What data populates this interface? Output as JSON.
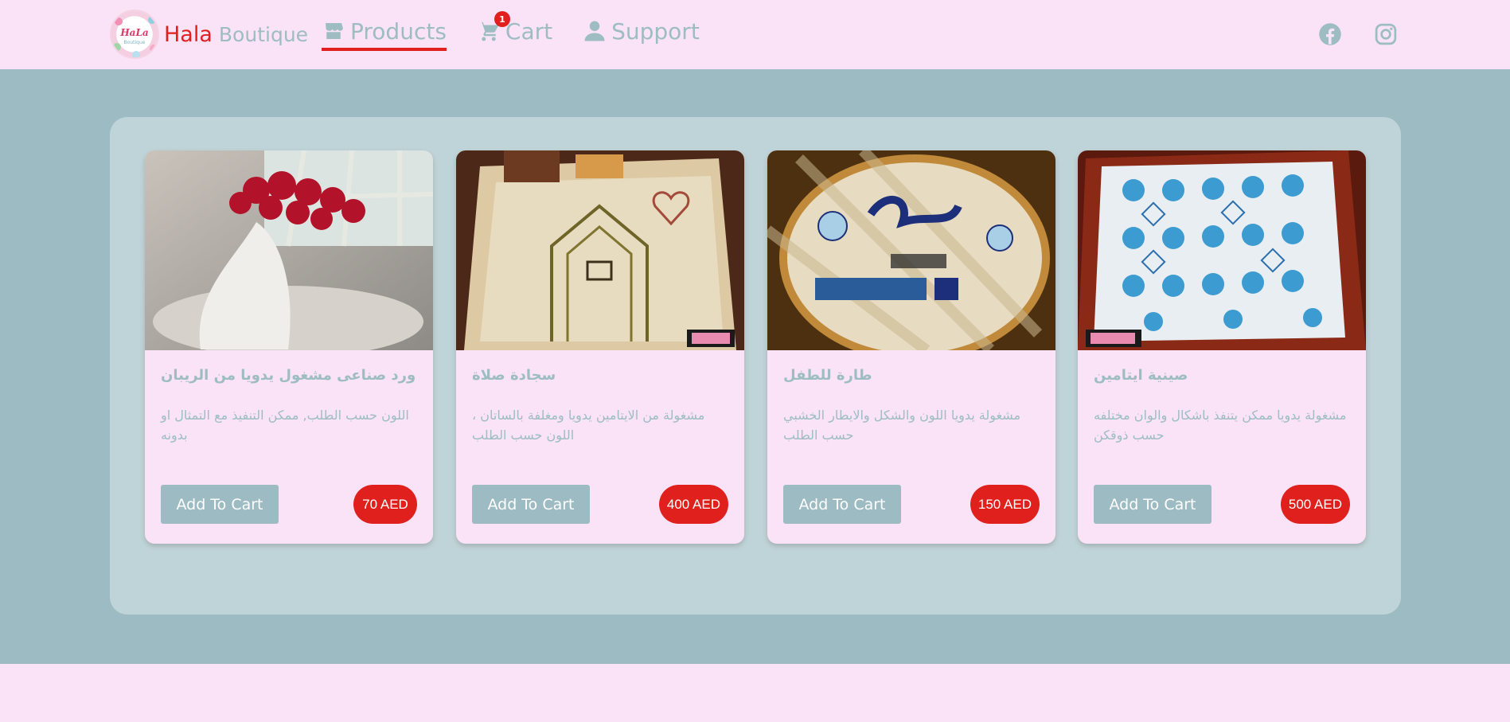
{
  "brand": {
    "logo_text": "HaLa",
    "logo_sub": "Boutique",
    "word1": "Hala",
    "word2": "Boutique"
  },
  "nav": {
    "items": [
      {
        "label": "Products",
        "icon": "store-icon",
        "active": true
      },
      {
        "label": "Cart",
        "icon": "cart-icon",
        "badge": "1"
      },
      {
        "label": "Support",
        "icon": "user-icon"
      }
    ]
  },
  "social": [
    "facebook-icon",
    "instagram-icon"
  ],
  "products": [
    {
      "title": "ورد صناعى مشغول يدويا من الريبان",
      "desc": "اللون حسب الطلب, ممكن التنفيذ مع التمثال او بدونه",
      "button": "Add To Cart",
      "price": "70 AED"
    },
    {
      "title": "سجادة صلاة",
      "desc": "مشغولة من الايتامين يدويا ومغلفة بالساتان ، اللون حسب الطلب",
      "button": "Add To Cart",
      "price": "400 AED"
    },
    {
      "title": "طارة للطفل",
      "desc": "مشغولة يدويا اللون والشكل والايطار الخشبي حسب الطلب",
      "button": "Add To Cart",
      "price": "150 AED"
    },
    {
      "title": "صينية ايتامين",
      "desc": "مشغولة يدويا ممكن يتنفذ باشكال والوان مختلفه حسب ذوقكن",
      "button": "Add To Cart",
      "price": "500 AED"
    }
  ],
  "colors": {
    "accent": "#e0201c",
    "muted": "#9dbdc3",
    "page_bg": "#fae3f6",
    "band_bg": "#9dbbc2",
    "panel_bg": "#bfd4d8"
  }
}
